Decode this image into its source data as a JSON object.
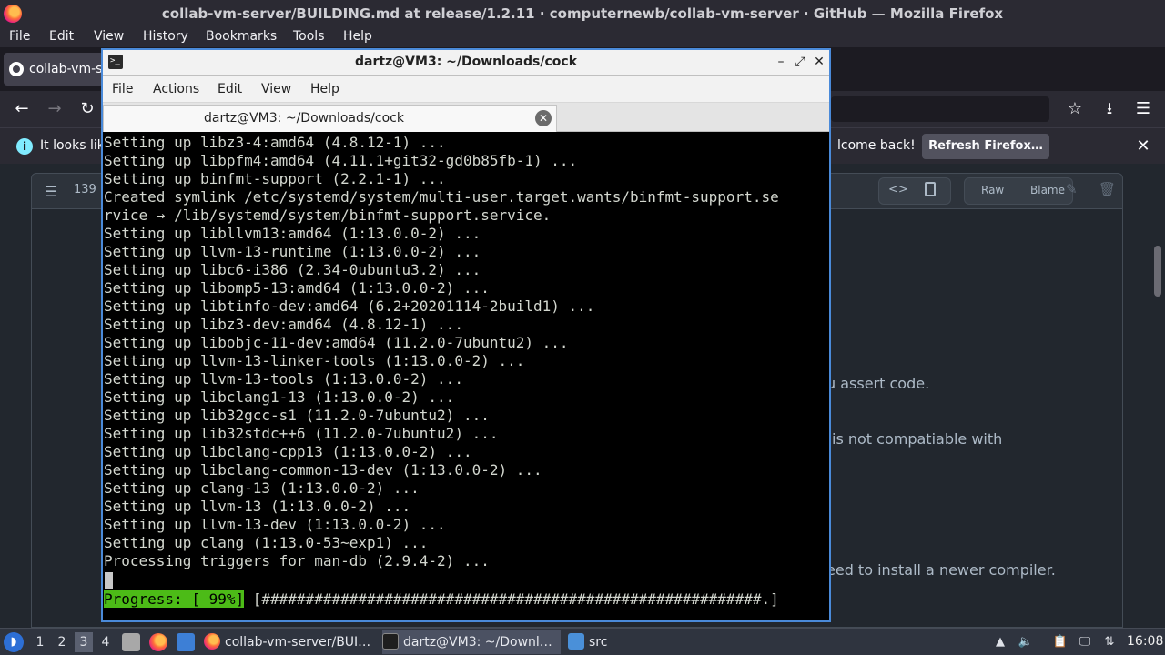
{
  "firefox": {
    "window_title": "collab-vm-server/BUILDING.md at release/1.2.11 · computernewb/collab-vm-server · GitHub — Mozilla Firefox",
    "menu": [
      "File",
      "Edit",
      "View",
      "History",
      "Bookmarks",
      "Tools",
      "Help"
    ],
    "tab_label": "collab-vm-se",
    "notification_left": "It looks lik",
    "notification_right": "lcome back!",
    "refresh_button": "Refresh Firefox…"
  },
  "github": {
    "line_count": "139",
    "raw_label": "Raw",
    "blame_label": "Blame",
    "text_1": "u assert code.",
    "text_2": "is not compatiable with",
    "text_3": "eed to install a newer compiler."
  },
  "terminal": {
    "window_title": "dartz@VM3: ~/Downloads/cock",
    "menu": [
      "File",
      "Actions",
      "Edit",
      "View",
      "Help"
    ],
    "tab_label": "dartz@VM3: ~/Downloads/cock",
    "lines": [
      "Setting up libz3-4:amd64 (4.8.12-1) ...",
      "Setting up libpfm4:amd64 (4.11.1+git32-gd0b85fb-1) ...",
      "Setting up binfmt-support (2.2.1-1) ...",
      "Created symlink /etc/systemd/system/multi-user.target.wants/binfmt-support.se",
      "rvice → /lib/systemd/system/binfmt-support.service.",
      "Setting up libllvm13:amd64 (1:13.0.0-2) ...",
      "Setting up llvm-13-runtime (1:13.0.0-2) ...",
      "Setting up libc6-i386 (2.34-0ubuntu3.2) ...",
      "Setting up libomp5-13:amd64 (1:13.0.0-2) ...",
      "Setting up libtinfo-dev:amd64 (6.2+20201114-2build1) ...",
      "Setting up libz3-dev:amd64 (4.8.12-1) ...",
      "Setting up libobjc-11-dev:amd64 (11.2.0-7ubuntu2) ...",
      "Setting up llvm-13-linker-tools (1:13.0.0-2) ...",
      "Setting up llvm-13-tools (1:13.0.0-2) ...",
      "Setting up libclang1-13 (1:13.0.0-2) ...",
      "Setting up lib32gcc-s1 (11.2.0-7ubuntu2) ...",
      "Setting up lib32stdc++6 (11.2.0-7ubuntu2) ...",
      "Setting up libclang-cpp13 (1:13.0.0-2) ...",
      "Setting up libclang-common-13-dev (1:13.0.0-2) ...",
      "Setting up clang-13 (1:13.0.0-2) ...",
      "Setting up llvm-13 (1:13.0.0-2) ...",
      "Setting up llvm-13-dev (1:13.0.0-2) ...",
      "Setting up clang (1:13.0-53~exp1) ...",
      "Processing triggers for man-db (2.9.4-2) ..."
    ],
    "progress_label": "Progress: [ 99%]",
    "progress_bar": " [#########################################################.]"
  },
  "taskbar": {
    "start_icon": "lubuntu-logo-icon",
    "workspaces": [
      "1",
      "2",
      "3",
      "4"
    ],
    "active_workspace": "3",
    "task_firefox": "collab-vm-server/BUI…",
    "task_terminal": "dartz@VM3: ~/Downl…",
    "task_files": "src",
    "clock": "16:08"
  }
}
